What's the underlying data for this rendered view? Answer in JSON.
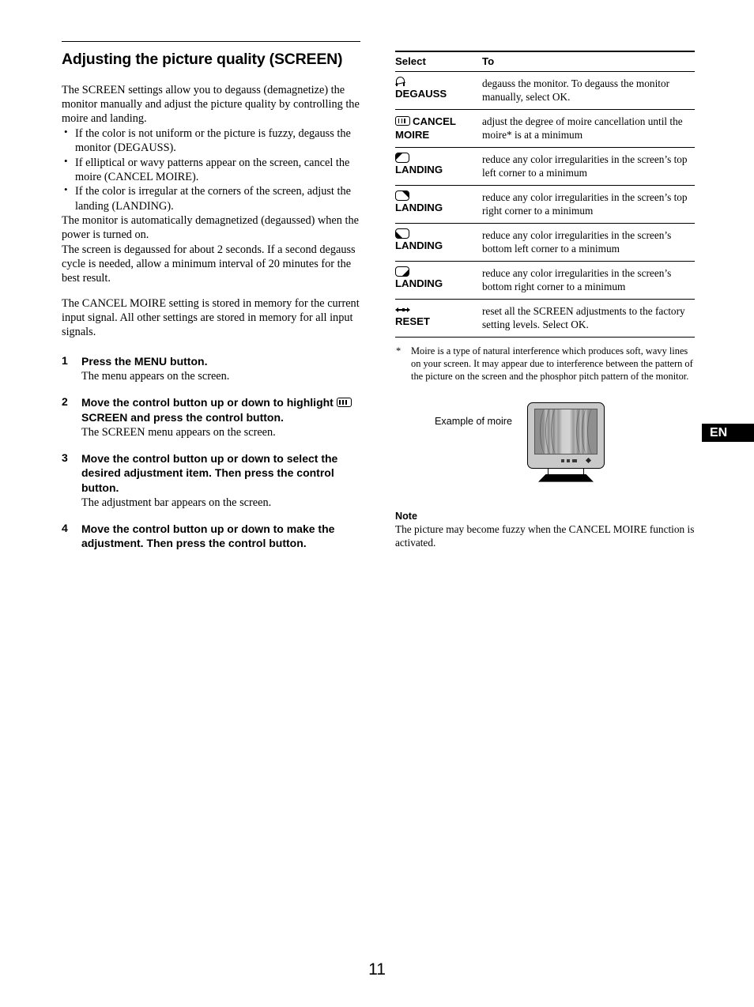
{
  "page": {
    "number": "11",
    "language_tab": "EN"
  },
  "left": {
    "title": "Adjusting the picture quality (SCREEN)",
    "intro": "The SCREEN settings allow you to degauss (demagnetize) the monitor manually and adjust the picture quality by controlling the moire and landing.",
    "bullets": [
      "If the color is not uniform or the picture is fuzzy, degauss the monitor (DEGAUSS).",
      "If elliptical or wavy patterns appear on the screen, cancel the moire (CANCEL MOIRE).",
      "If the color is irregular at the corners of the screen, adjust the landing (LANDING)."
    ],
    "para_auto": "The monitor is automatically demagnetized (degaussed) when the power is turned on.",
    "para_cycle": "The screen is degaussed for about 2 seconds. If a second degauss cycle is needed, allow a minimum interval of 20 minutes for the best result.",
    "para_memory": "The CANCEL MOIRE setting is stored in memory for the current input signal. All other settings are stored in memory for all input signals.",
    "steps": [
      {
        "num": "1",
        "head": "Press the MENU button.",
        "sub": "The menu appears on the screen."
      },
      {
        "num": "2",
        "head_before": "Move the control button up or down to highlight",
        "head_after": "SCREEN and press the control button.",
        "sub": "The SCREEN menu appears on the screen."
      },
      {
        "num": "3",
        "head": "Move the control button up or down to select the desired adjustment item. Then press the control button.",
        "sub": "The adjustment bar appears on the screen."
      },
      {
        "num": "4",
        "head": "Move the control button up or down to make the adjustment. Then press the control button.",
        "sub": ""
      }
    ]
  },
  "right": {
    "table": {
      "headers": [
        "Select",
        "To"
      ],
      "rows": [
        {
          "icon": "degauss-icon",
          "select": "DEGAUSS",
          "to": "degauss the monitor. To degauss the monitor manually, select OK."
        },
        {
          "icon": "cancel-moire-icon",
          "select": "CANCEL MOIRE",
          "to": "adjust the degree of moire cancellation until the moire* is at a minimum"
        },
        {
          "icon": "landing-top-left-icon",
          "select": "LANDING",
          "to": "reduce any color irregularities in the screen’s top left corner to a minimum"
        },
        {
          "icon": "landing-top-right-icon",
          "select": "LANDING",
          "to": "reduce any color irregularities in the screen’s top right corner to a minimum"
        },
        {
          "icon": "landing-bottom-left-icon",
          "select": "LANDING",
          "to": "reduce any color irregularities in the screen’s bottom left corner to a minimum"
        },
        {
          "icon": "landing-bottom-right-icon",
          "select": "LANDING",
          "to": "reduce any color irregularities in the screen’s bottom right corner to a minimum"
        },
        {
          "icon": "reset-icon",
          "select": "RESET",
          "to": "reset all the SCREEN adjustments to the factory setting levels. Select OK."
        }
      ]
    },
    "footnote": {
      "marker": "*",
      "text": "Moire is a type of natural interference which produces soft, wavy lines on your screen. It may appear due to interference between the pattern of the picture on the screen and the phosphor pitch pattern of the monitor."
    },
    "figure": {
      "caption": "Example of moire"
    },
    "note": {
      "title": "Note",
      "text": "The picture may become fuzzy when the CANCEL MOIRE function is activated."
    }
  }
}
